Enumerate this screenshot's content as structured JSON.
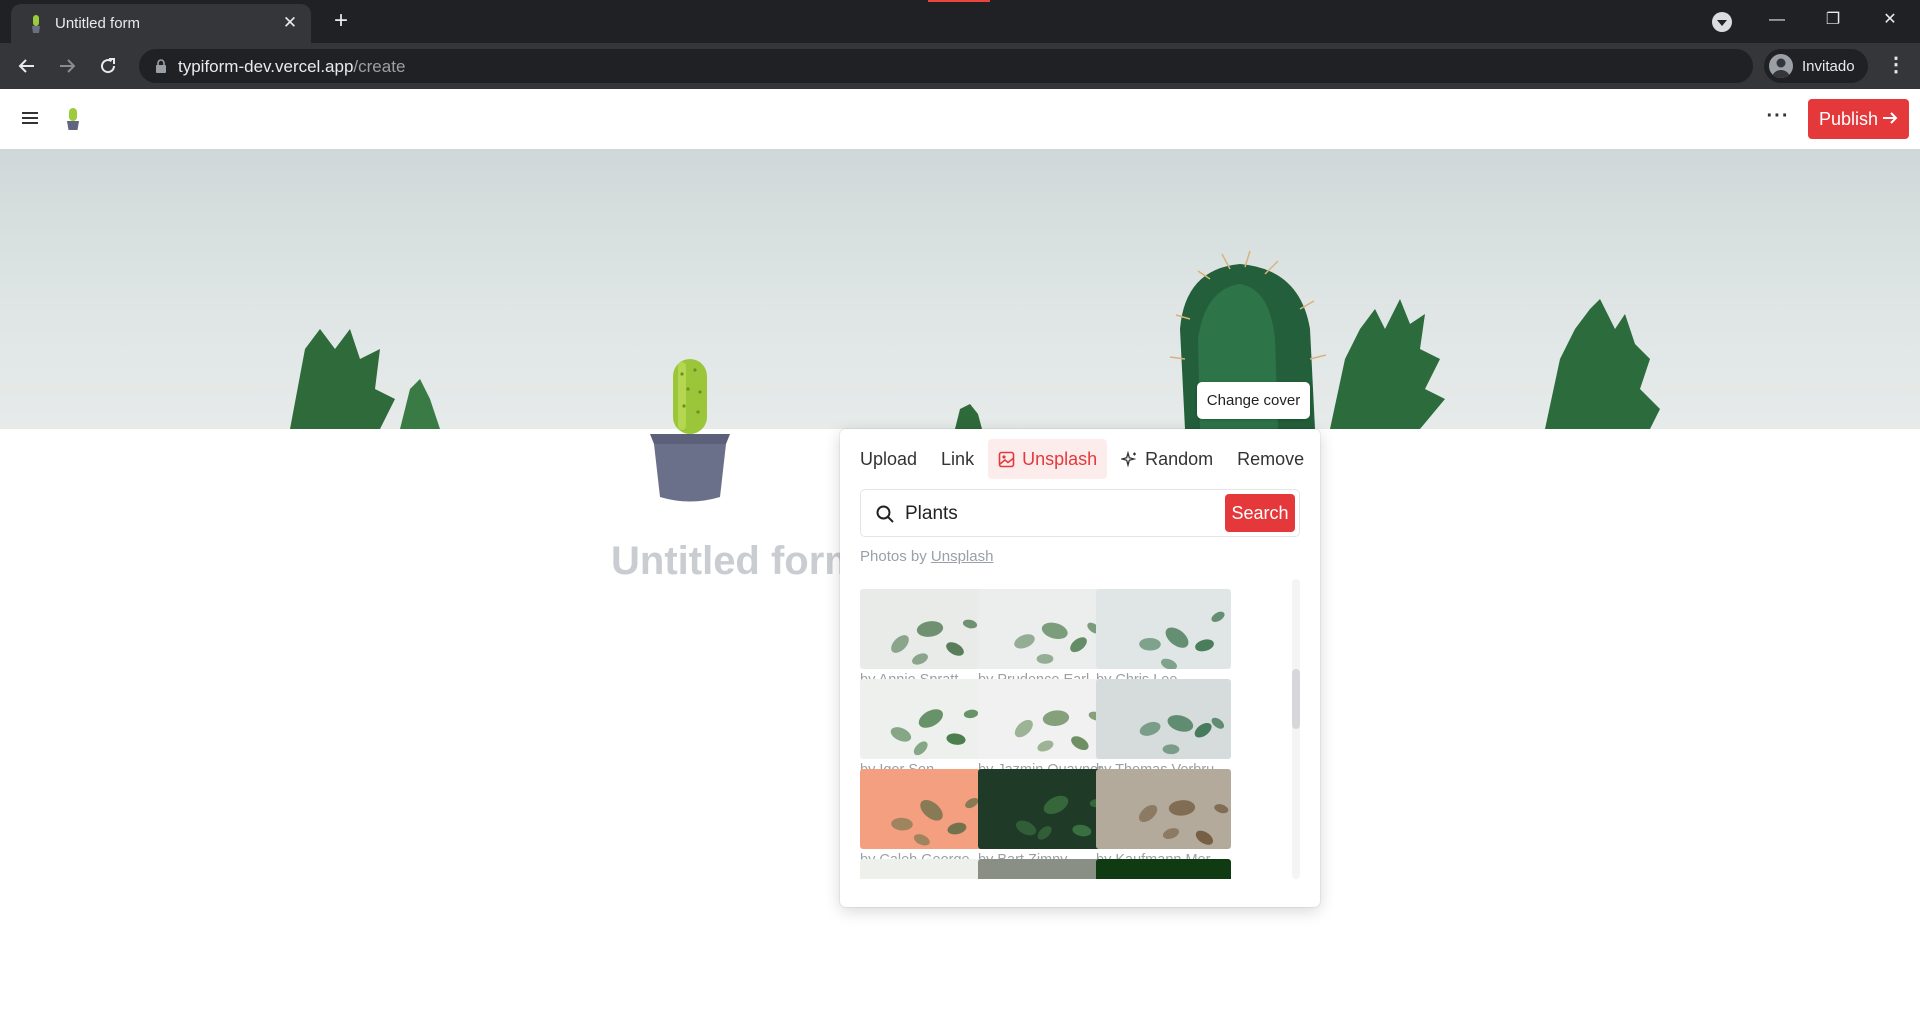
{
  "browser": {
    "tab_title": "Untitled form",
    "tab_close": "✕",
    "new_tab": "+",
    "url_host": "typiform-dev.vercel.app",
    "url_path": "/create",
    "profile_label": "Invitado",
    "win_minimize": "—",
    "win_restore": "❐",
    "win_close": "✕"
  },
  "app": {
    "publish_label": "Publish",
    "more_label": "···",
    "change_cover_label": "Change cover",
    "form_title": "Untitled form"
  },
  "cover_popover": {
    "tabs": [
      {
        "label": "Upload",
        "icon": null
      },
      {
        "label": "Link",
        "icon": null
      },
      {
        "label": "Unsplash",
        "icon": "image-icon",
        "active": true
      },
      {
        "label": "Random",
        "icon": "sparkle-icon"
      },
      {
        "label": "Remove",
        "icon": null
      }
    ],
    "search_value": "Plants",
    "search_button": "Search",
    "credit_prefix": "Photos by",
    "credit_link": "Unsplash",
    "by": "by",
    "photos": [
      {
        "author": "Annie Spratt",
        "palette": [
          "#e8ebe8",
          "#3d6b3e"
        ]
      },
      {
        "author": "Prudence Earl",
        "palette": [
          "#eceeed",
          "#4c7a4c"
        ]
      },
      {
        "author": "Chris Lee",
        "palette": [
          "#dfe6e5",
          "#2f6a43"
        ]
      },
      {
        "author": "Igor Son",
        "palette": [
          "#eef0ee",
          "#2f6b30"
        ]
      },
      {
        "author": "Jazmin Quaynor",
        "palette": [
          "#f0f1f0",
          "#577f4a"
        ]
      },
      {
        "author": "Thomas Verbruggen",
        "palette": [
          "#d5dcdb",
          "#2d6a45"
        ]
      },
      {
        "author": "Caleb George",
        "palette": [
          "#f49f80",
          "#5b6b44"
        ]
      },
      {
        "author": "Bart Zimny",
        "palette": [
          "#1f3a27",
          "#3f7a45"
        ]
      },
      {
        "author": "Kaufmann Mercantile",
        "palette": [
          "#b3aa9c",
          "#6b5236"
        ]
      },
      {
        "author": "",
        "palette": [
          "#eef0ec",
          "#2f5f2b"
        ]
      },
      {
        "author": "",
        "palette": [
          "#8a8f86",
          "#c65a4d"
        ]
      },
      {
        "author": "",
        "palette": [
          "#0f3a12",
          "#2d7a2a"
        ]
      }
    ]
  },
  "colors": {
    "brand": "#e5383b",
    "brand_light": "#fdecec",
    "chrome_dark": "#202124",
    "chrome_mid": "#35363a"
  }
}
